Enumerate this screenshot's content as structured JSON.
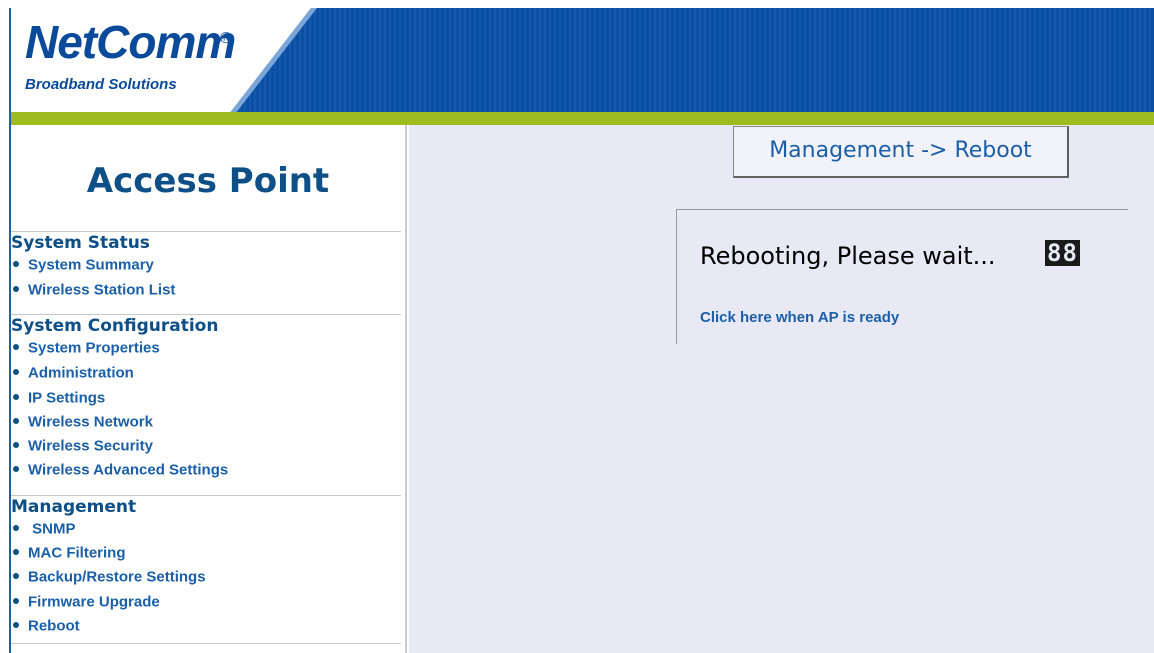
{
  "header": {
    "logo_main": "NetComm",
    "logo_reg": "®",
    "logo_sub": "Broadband Solutions",
    "colors": {
      "header_blue": "#0c4fa0",
      "accent_green": "#9dbd1e"
    }
  },
  "sidebar": {
    "title": "Access Point",
    "sections": [
      {
        "heading": "System Status",
        "items": [
          "System Summary",
          "Wireless Station List"
        ]
      },
      {
        "heading": "System Configuration",
        "items": [
          "System Properties",
          "Administration",
          "IP Settings",
          "Wireless Network",
          "Wireless Security",
          "Wireless Advanced Settings"
        ]
      },
      {
        "heading": "Management",
        "items": [
          " SNMP",
          "MAC Filtering",
          "Backup/Restore Settings",
          "Firmware Upgrade",
          "Reboot"
        ]
      }
    ]
  },
  "main": {
    "page_title": "Management -> Reboot",
    "reboot_message": "Rebooting, Please wait...",
    "counter": "88",
    "ready_link": "Click here when AP is ready"
  }
}
